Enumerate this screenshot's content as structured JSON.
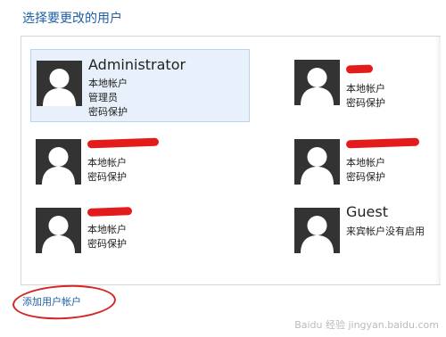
{
  "heading": "选择要更改的用户",
  "users": [
    {
      "name": "Administrator",
      "lines": [
        "本地帐户",
        "管理员",
        "密码保护"
      ],
      "redacted": false,
      "selected": true
    },
    {
      "name": "",
      "lines": [
        "本地帐户",
        "密码保护"
      ],
      "redacted": true,
      "selected": false
    },
    {
      "name": "",
      "lines": [
        "本地帐户",
        "密码保护"
      ],
      "redacted": true,
      "selected": false
    },
    {
      "name": "",
      "lines": [
        "本地帐户",
        "密码保护"
      ],
      "redacted": true,
      "selected": false
    },
    {
      "name": "",
      "lines": [
        "本地帐户",
        "密码保护"
      ],
      "redacted": true,
      "selected": false
    },
    {
      "name": "Guest",
      "lines": [
        "来宾帐户没有启用"
      ],
      "redacted": false,
      "selected": false
    }
  ],
  "add_account_link": "添加用户帐户",
  "watermark": "Baidu 经验 jingyan.baidu.com",
  "colors": {
    "link": "#1f5fa5",
    "highlight": "#e8f1fb",
    "annotation": "#d62323",
    "redaction": "#e41b1b"
  }
}
